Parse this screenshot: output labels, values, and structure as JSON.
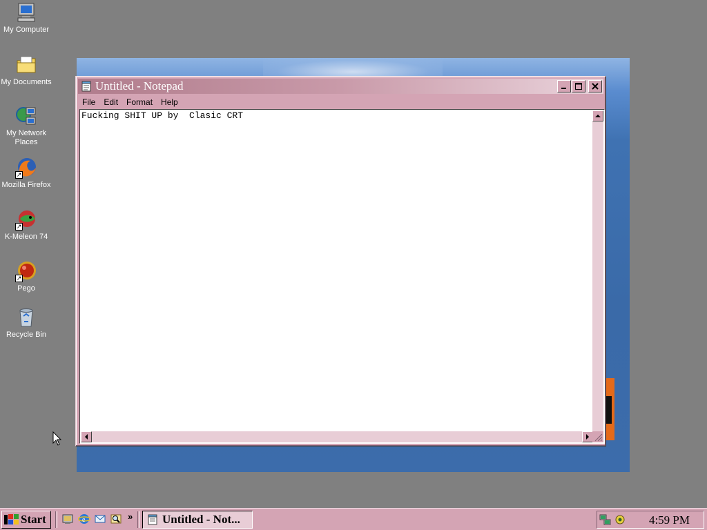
{
  "desktop": {
    "icons": [
      {
        "label": "My Computer",
        "icon": "computer-icon"
      },
      {
        "label": "My Documents",
        "icon": "folder-icon"
      },
      {
        "label": "My Network Places",
        "icon": "network-icon"
      },
      {
        "label": "Mozilla Firefox",
        "icon": "firefox-icon"
      },
      {
        "label": "K-Meleon 74",
        "icon": "kmeleon-icon"
      },
      {
        "label": "Pego",
        "icon": "pego-icon"
      },
      {
        "label": "Recycle Bin",
        "icon": "recycle-bin-icon"
      }
    ]
  },
  "notepad": {
    "title": "Untitled - Notepad",
    "menu": [
      "File",
      "Edit",
      "Format",
      "Help"
    ],
    "content": "Fucking SHIT UP by  Clasic CRT"
  },
  "taskbar": {
    "start_label": "Start",
    "quick_launch_more": "»",
    "task_label": "Untitled - Not...",
    "clock": "4:59 PM"
  },
  "colors": {
    "desktop": "#808080",
    "window_face": "#d4a4b4",
    "titlebar_start": "#b07c8c",
    "titlebar_end": "#ead4dc"
  }
}
